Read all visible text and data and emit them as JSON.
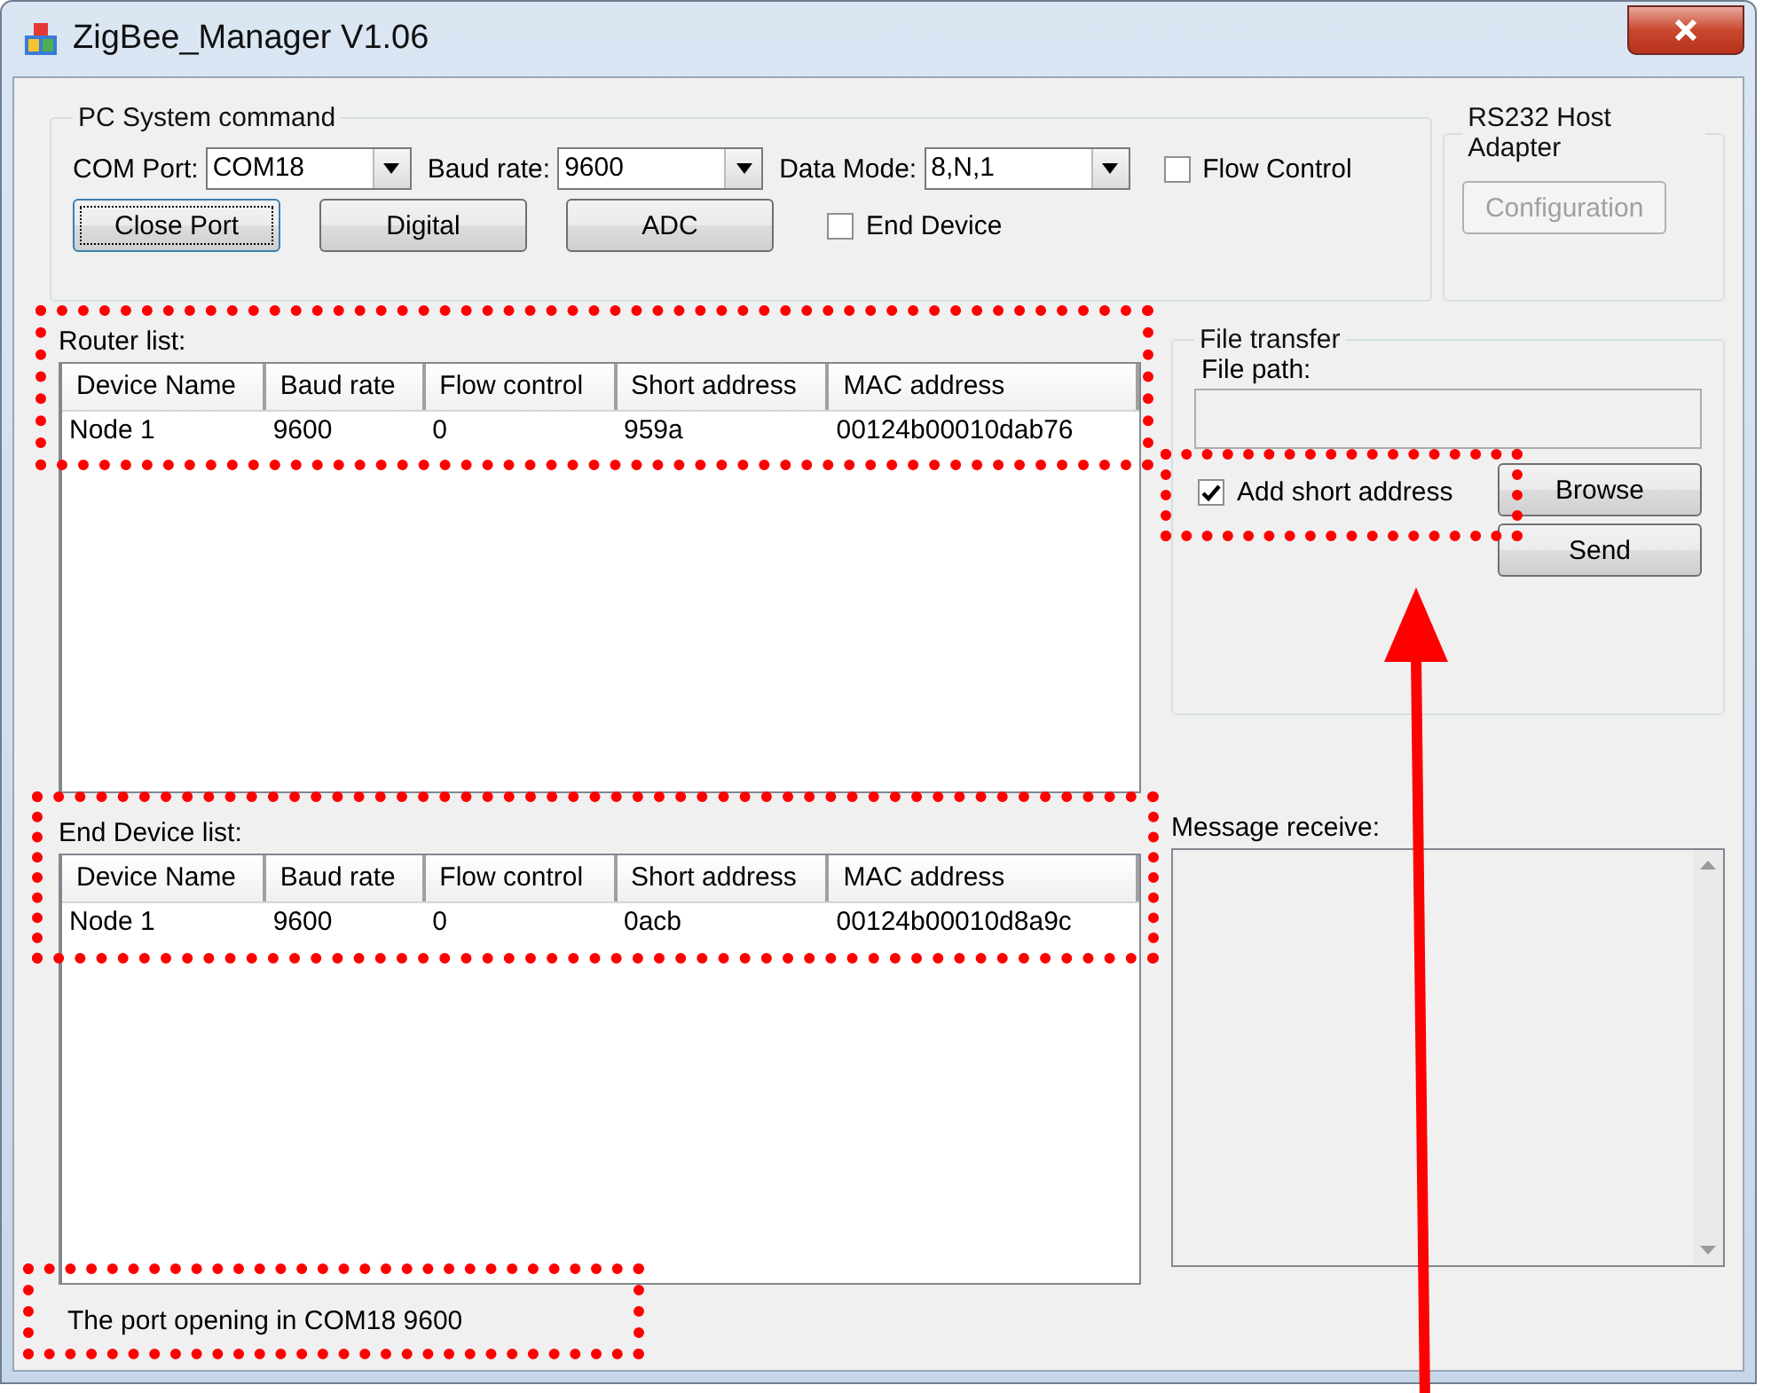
{
  "window": {
    "title": "ZigBee_Manager V1.06"
  },
  "pc_system_command": {
    "title": "PC System command",
    "com_port": {
      "label": "COM Port:",
      "value": "COM18"
    },
    "baud_rate": {
      "label": "Baud rate:",
      "value": "9600"
    },
    "data_mode": {
      "label": "Data Mode:",
      "value": "8,N,1"
    },
    "flow_control": {
      "label": "Flow Control",
      "checked": false
    },
    "buttons": [
      {
        "label": "Close Port",
        "focused": true
      },
      {
        "label": "Digital",
        "focused": false
      },
      {
        "label": "ADC",
        "focused": false
      }
    ],
    "end_device": {
      "label": "End Device",
      "checked": false
    }
  },
  "rs232_host_adapter": {
    "title": "RS232 Host Adapter",
    "button": {
      "label": "Configuration",
      "disabled": true
    }
  },
  "router_list": {
    "label": "Router list:",
    "highlighted": true,
    "columns": [
      "Device Name",
      "Baud rate",
      "Flow control",
      "Short address",
      "MAC address"
    ],
    "rows": [
      [
        "Node 1",
        "9600",
        "0",
        "959a",
        "00124b00010dab76"
      ]
    ]
  },
  "end_device_list": {
    "label": "End Device list:",
    "highlighted": true,
    "columns": [
      "Device Name",
      "Baud rate",
      "Flow control",
      "Short address",
      "MAC address"
    ],
    "rows": [
      [
        "Node 1",
        "9600",
        "0",
        "0acb",
        "00124b00010d8a9c"
      ]
    ]
  },
  "file_transfer": {
    "title": "File transfer",
    "file_path_label": "File path:",
    "add_short_address": {
      "label": "Add short address",
      "checked": true,
      "highlighted": true,
      "pointed_at": true
    },
    "buttons": [
      "Browse",
      "Send"
    ]
  },
  "message_receive": {
    "label": "Message receive:"
  },
  "status_bar": {
    "text": "The port opening in COM18 9600",
    "highlighted": true
  }
}
